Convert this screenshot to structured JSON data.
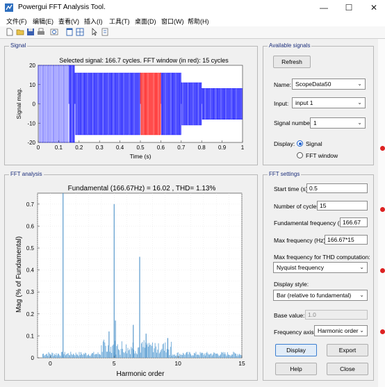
{
  "window": {
    "title": "Powergui FFT Analysis Tool."
  },
  "menu": [
    "文件(F)",
    "编辑(E)",
    "查看(V)",
    "插入(I)",
    "工具(T)",
    "桌面(D)",
    "窗口(W)",
    "帮助(H)"
  ],
  "toolbar_icons": [
    "new-file-icon",
    "open-folder-icon",
    "save-icon",
    "print-icon",
    "print-preview-icon",
    "dock-icon",
    "layout-icon",
    "pointer-icon",
    "insert-legend-icon"
  ],
  "signal_panel": {
    "title": "Signal",
    "plot_title": "Selected signal: 166.7 cycles. FFT window (in red): 15 cycles",
    "ylabel": "Signal mag.",
    "xlabel": "Time (s)",
    "yticks": [
      "20",
      "10",
      "0",
      "-10",
      "-20"
    ],
    "xticks": [
      "0",
      "0.1",
      "0.2",
      "0.3",
      "0.4",
      "0.5",
      "0.6",
      "0.7",
      "0.8",
      "0.9",
      "1"
    ]
  },
  "fft_panel": {
    "title": "FFT analysis",
    "plot_title": "Fundamental (166.67Hz) = 16.02 , THD= 1.13%",
    "ylabel": "Mag (% of Fundamental)",
    "xlabel": "Harmonic order",
    "yticks": [
      "0.7",
      "0.6",
      "0.5",
      "0.4",
      "0.3",
      "0.2",
      "0.1",
      "0"
    ],
    "xticks": [
      "0",
      "5",
      "10",
      "15"
    ]
  },
  "available_signals": {
    "title": "Available signals",
    "refresh_label": "Refresh",
    "name_label": "Name:",
    "name_value": "ScopeData50",
    "input_label": "Input:",
    "input_value": "input 1",
    "signal_number_label": "Signal number:",
    "signal_number_value": "1",
    "display_label": "Display:",
    "display_options": [
      "Signal",
      "FFT window"
    ],
    "display_selected": "Signal"
  },
  "fft_settings": {
    "title": "FFT settings",
    "start_time_label": "Start time (s):",
    "start_time_value": "0.5",
    "cycles_label": "Number of cycles:",
    "cycles_value": "15",
    "fund_freq_label": "Fundamental frequency (Hz):",
    "fund_freq_value": "166.67",
    "max_freq_label": "Max frequency (Hz):",
    "max_freq_value": "166.67*15",
    "thd_label": "Max frequency for THD computation:",
    "thd_value": "Nyquist frequency",
    "display_style_label": "Display style:",
    "display_style_value": "Bar (relative to fundamental)",
    "base_value_label": "Base value:",
    "base_value_value": "1.0",
    "freq_axis_label": "Frequency axis:",
    "freq_axis_value": "Harmonic order",
    "display_button": "Display",
    "export_button": "Export",
    "help_button": "Help",
    "close_button": "Close"
  },
  "chart_data": [
    {
      "type": "line",
      "title": "Selected signal: 166.7 cycles. FFT window (in red): 15 cycles",
      "xlabel": "Time (s)",
      "ylabel": "Signal mag.",
      "xlim": [
        0,
        1
      ],
      "ylim": [
        -20,
        20
      ],
      "grid": false,
      "series": [
        {
          "color": "#0000ff",
          "segments": [
            {
              "t0": 0.0,
              "t1": 0.15,
              "amp": 20
            },
            {
              "t0": 0.15,
              "t1": 0.18,
              "amp": 20
            },
            {
              "t0": 0.18,
              "t1": 0.5,
              "amp": 16
            },
            {
              "t0": 0.6,
              "t1": 0.7,
              "amp": 16
            },
            {
              "t0": 0.7,
              "t1": 0.8,
              "amp": 11
            },
            {
              "t0": 0.8,
              "t1": 1.0,
              "amp": 8
            }
          ]
        },
        {
          "color": "#ff0000",
          "segments": [
            {
              "t0": 0.5,
              "t1": 0.6,
              "amp": 16
            }
          ]
        }
      ]
    },
    {
      "type": "bar",
      "title": "Fundamental (166.67Hz) = 16.02 , THD= 1.13%",
      "xlabel": "Harmonic order",
      "ylabel": "Mag (% of Fundamental)",
      "xlim": [
        -1,
        15
      ],
      "ylim": [
        0,
        0.75
      ],
      "grid": true,
      "peaks": [
        {
          "h": 1,
          "value": 0.75
        },
        {
          "h": 5,
          "value": 0.7
        },
        {
          "h": 7,
          "value": 0.46
        },
        {
          "h": 5.1,
          "value": 0.17
        },
        {
          "h": 6.5,
          "value": 0.15
        },
        {
          "h": 7.5,
          "value": 0.11
        },
        {
          "h": 4.6,
          "value": 0.12
        },
        {
          "h": 9.2,
          "value": 0.09
        }
      ]
    }
  ]
}
